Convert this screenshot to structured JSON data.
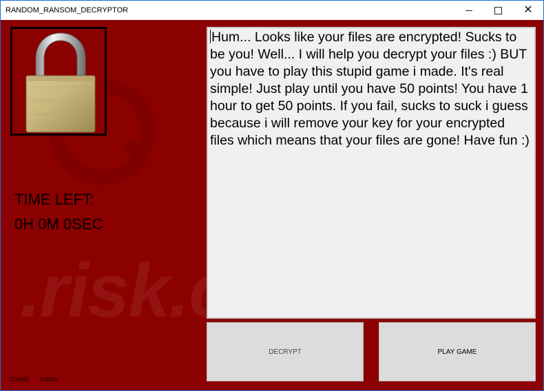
{
  "window": {
    "title": "RANDOM_RANSOM_DECRYPTOR",
    "controls": [
      "minimize-icon",
      "maximize-icon",
      "close-icon"
    ]
  },
  "lock": {
    "icon": "padlock-icon"
  },
  "timer": {
    "label": "TIME LEFT:",
    "value": "0H 0M 0SEC"
  },
  "message": {
    "text": "Hum... Looks like your files are encrypted! Sucks to be you! Well... I will help you decrypt your files :) BUT you have to play this stupid game i made. It's real simple! Just play until you have 50 points! You have 1 hour to get 50 points. If you fail, sucks to suck i guess because i will remove your key for your encrypted files which means that your files are gone! Have fun :)"
  },
  "buttons": {
    "decrypt_label": "DECRYPT",
    "play_label": "PLAY GAME"
  },
  "tokens": [
    "TOKEN",
    "TOKEN"
  ],
  "watermark": ".risk.com",
  "colors": {
    "background": "#8b0000",
    "panel": "#f0f0f0",
    "button": "#dcdcdc"
  }
}
